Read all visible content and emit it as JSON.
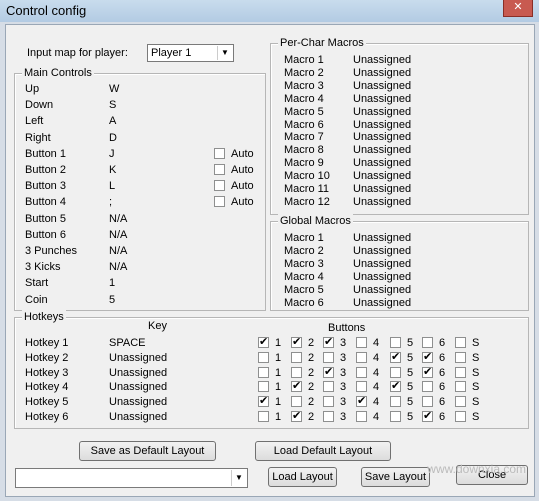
{
  "window": {
    "title": "Control config",
    "close": "✕"
  },
  "input_map": {
    "label": "Input map for player:",
    "value": "Player 1"
  },
  "main_controls": {
    "title": "Main Controls",
    "rows": [
      {
        "name": "Up",
        "key": "W"
      },
      {
        "name": "Down",
        "key": "S"
      },
      {
        "name": "Left",
        "key": "A"
      },
      {
        "name": "Right",
        "key": "D"
      },
      {
        "name": "Button 1",
        "key": "J"
      },
      {
        "name": "Button 2",
        "key": "K"
      },
      {
        "name": "Button 3",
        "key": "L"
      },
      {
        "name": "Button 4",
        "key": ";"
      },
      {
        "name": "Button 5",
        "key": "N/A"
      },
      {
        "name": "Button 6",
        "key": "N/A"
      },
      {
        "name": "3 Punches",
        "key": "N/A"
      },
      {
        "name": "3 Kicks",
        "key": "N/A"
      },
      {
        "name": "Start",
        "key": "1"
      },
      {
        "name": "Coin",
        "key": "5"
      }
    ],
    "auto_label": "Auto"
  },
  "per_char_macros": {
    "title": "Per-Char Macros",
    "rows": [
      {
        "name": "Macro 1",
        "value": "Unassigned"
      },
      {
        "name": "Macro 2",
        "value": "Unassigned"
      },
      {
        "name": "Macro 3",
        "value": "Unassigned"
      },
      {
        "name": "Macro 4",
        "value": "Unassigned"
      },
      {
        "name": "Macro 5",
        "value": "Unassigned"
      },
      {
        "name": "Macro 6",
        "value": "Unassigned"
      },
      {
        "name": "Macro 7",
        "value": "Unassigned"
      },
      {
        "name": "Macro 8",
        "value": "Unassigned"
      },
      {
        "name": "Macro 9",
        "value": "Unassigned"
      },
      {
        "name": "Macro 10",
        "value": "Unassigned"
      },
      {
        "name": "Macro 11",
        "value": "Unassigned"
      },
      {
        "name": "Macro 12",
        "value": "Unassigned"
      }
    ]
  },
  "global_macros": {
    "title": "Global Macros",
    "rows": [
      {
        "name": "Macro 1",
        "value": "Unassigned"
      },
      {
        "name": "Macro 2",
        "value": "Unassigned"
      },
      {
        "name": "Macro 3",
        "value": "Unassigned"
      },
      {
        "name": "Macro 4",
        "value": "Unassigned"
      },
      {
        "name": "Macro 5",
        "value": "Unassigned"
      },
      {
        "name": "Macro 6",
        "value": "Unassigned"
      }
    ]
  },
  "hotkeys": {
    "title": "Hotkeys",
    "key_header": "Key",
    "buttons_header": "Buttons",
    "button_labels": [
      "1",
      "2",
      "3",
      "4",
      "5",
      "6",
      "S"
    ],
    "rows": [
      {
        "name": "Hotkey 1",
        "key": "SPACE",
        "checks": [
          true,
          true,
          true,
          false,
          false,
          false,
          false
        ]
      },
      {
        "name": "Hotkey 2",
        "key": "Unassigned",
        "checks": [
          false,
          false,
          false,
          false,
          true,
          true,
          false
        ]
      },
      {
        "name": "Hotkey 3",
        "key": "Unassigned",
        "checks": [
          false,
          false,
          true,
          false,
          false,
          true,
          false
        ]
      },
      {
        "name": "Hotkey 4",
        "key": "Unassigned",
        "checks": [
          false,
          true,
          false,
          false,
          true,
          false,
          false
        ]
      },
      {
        "name": "Hotkey 5",
        "key": "Unassigned",
        "checks": [
          true,
          false,
          false,
          true,
          false,
          false,
          false
        ]
      },
      {
        "name": "Hotkey 6",
        "key": "Unassigned",
        "checks": [
          false,
          true,
          false,
          false,
          false,
          true,
          false
        ]
      }
    ]
  },
  "buttons": {
    "save_default": "Save as  Default Layout",
    "load_default": "Load Default Layout",
    "load_layout": "Load Layout",
    "save_layout": "Save Layout",
    "close": "Close"
  },
  "layout_combo": {
    "value": ""
  },
  "watermark": "www.downxia.com"
}
